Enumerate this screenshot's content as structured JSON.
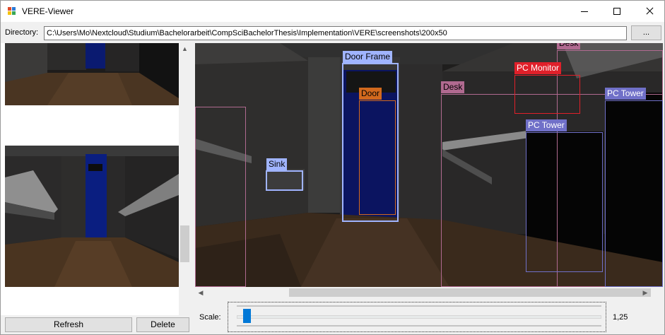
{
  "window": {
    "title": "VERE-Viewer"
  },
  "directory": {
    "label": "Directory:",
    "value": "C:\\Users\\Mo\\Nextcloud\\Studium\\Bachelorarbeit\\CompSciBachelorThesis\\Implementation\\VERE\\screenshots\\200x50",
    "browse_label": "..."
  },
  "buttons": {
    "refresh": "Refresh",
    "delete": "Delete"
  },
  "annotations": [
    {
      "label": "Door Frame",
      "color": "#a0b4ff",
      "text_color": "#000000"
    },
    {
      "label": "Door",
      "color": "#d2691e",
      "text_color": "#000000"
    },
    {
      "label": "Desk",
      "color": "#b06a90",
      "text_color": "#000000"
    },
    {
      "label": "Desk",
      "color": "#b06a90",
      "text_color": "#000000"
    },
    {
      "label": "PC Monitor",
      "color": "#e0202a",
      "text_color": "#ffffff"
    },
    {
      "label": "PC Tower",
      "color": "#7070c8",
      "text_color": "#ffffff"
    },
    {
      "label": "PC Tower",
      "color": "#7070c8",
      "text_color": "#ffffff"
    },
    {
      "label": "Sink",
      "color": "#a0b4ff",
      "text_color": "#000000"
    }
  ],
  "scale": {
    "label": "Scale:",
    "value": "1,25"
  }
}
